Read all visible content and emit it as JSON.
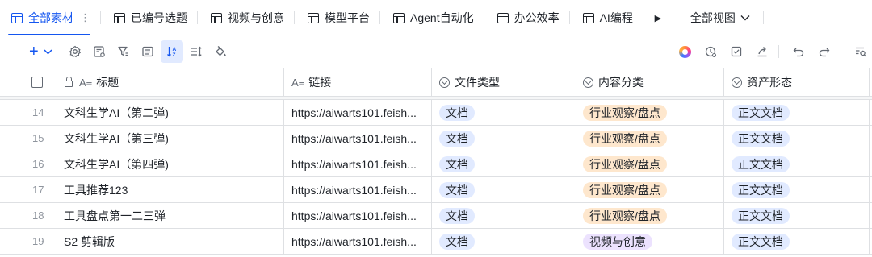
{
  "tabs": [
    {
      "label": "全部素材",
      "active": true
    },
    {
      "label": "已编号选题",
      "active": false
    },
    {
      "label": "视频与创意",
      "active": false
    },
    {
      "label": "模型平台",
      "active": false
    },
    {
      "label": "Agent自动化",
      "active": false
    },
    {
      "label": "办公效率",
      "active": false
    },
    {
      "label": "AI编程",
      "active": false
    }
  ],
  "tab_overflow_icon": "play-right-icon",
  "all_views_label": "全部视图",
  "toolbar": {
    "add_icon": "plus-icon",
    "left_icons": [
      "settings-icon",
      "field-config-icon",
      "filter-icon",
      "group-icon",
      "sort-icon",
      "row-height-icon",
      "fill-color-icon"
    ],
    "right_icons": [
      "ai-ring-icon",
      "history-icon",
      "checklist-icon",
      "share-icon",
      "undo-icon",
      "redo-icon",
      "search-icon"
    ]
  },
  "columns": {
    "title": "标题",
    "link": "链接",
    "file_type": "文件类型",
    "category": "内容分类",
    "asset_form": "资产形态"
  },
  "rows": [
    {
      "num": "14",
      "title": "文科生学AI（第二弹)",
      "link": "https://aiwarts101.feish...",
      "file_type": "文档",
      "category": "行业观察/盘点",
      "asset_form": "正文文档"
    },
    {
      "num": "15",
      "title": "文科生学AI（第三弹)",
      "link": "https://aiwarts101.feish...",
      "file_type": "文档",
      "category": "行业观察/盘点",
      "asset_form": "正文文档"
    },
    {
      "num": "16",
      "title": "文科生学AI（第四弹)",
      "link": "https://aiwarts101.feish...",
      "file_type": "文档",
      "category": "行业观察/盘点",
      "asset_form": "正文文档"
    },
    {
      "num": "17",
      "title": "工具推荐123",
      "link": "https://aiwarts101.feish...",
      "file_type": "文档",
      "category": "行业观察/盘点",
      "asset_form": "正文文档"
    },
    {
      "num": "18",
      "title": "工具盘点第一二三弹",
      "link": "https://aiwarts101.feish...",
      "file_type": "文档",
      "category": "行业观察/盘点",
      "asset_form": "正文文档"
    },
    {
      "num": "19",
      "title": "S2 剪辑版",
      "link": "https://aiwarts101.feish...",
      "file_type": "文档",
      "category": "视频与创意",
      "asset_form": "正文文档"
    }
  ],
  "tag_colors": {
    "文档": "#e1eaff",
    "行业观察/盘点": "#fee7cd",
    "视频与创意": "#ece2fe",
    "正文文档": "#e1eaff"
  },
  "colors": {
    "accent": "#1456f0",
    "border": "#dee0e3"
  }
}
